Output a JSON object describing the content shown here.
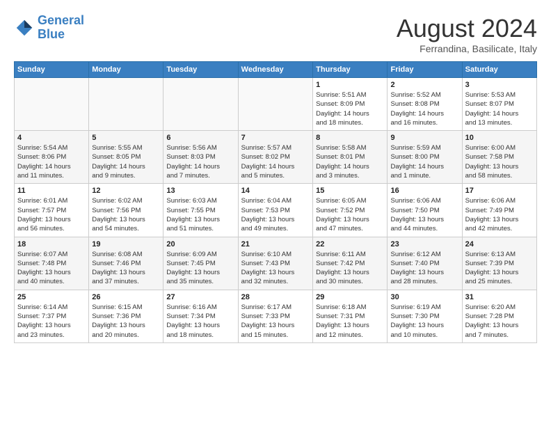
{
  "header": {
    "logo_line1": "General",
    "logo_line2": "Blue",
    "month": "August 2024",
    "location": "Ferrandina, Basilicate, Italy"
  },
  "weekdays": [
    "Sunday",
    "Monday",
    "Tuesday",
    "Wednesday",
    "Thursday",
    "Friday",
    "Saturday"
  ],
  "weeks": [
    [
      {
        "day": "",
        "info": ""
      },
      {
        "day": "",
        "info": ""
      },
      {
        "day": "",
        "info": ""
      },
      {
        "day": "",
        "info": ""
      },
      {
        "day": "1",
        "info": "Sunrise: 5:51 AM\nSunset: 8:09 PM\nDaylight: 14 hours\nand 18 minutes."
      },
      {
        "day": "2",
        "info": "Sunrise: 5:52 AM\nSunset: 8:08 PM\nDaylight: 14 hours\nand 16 minutes."
      },
      {
        "day": "3",
        "info": "Sunrise: 5:53 AM\nSunset: 8:07 PM\nDaylight: 14 hours\nand 13 minutes."
      }
    ],
    [
      {
        "day": "4",
        "info": "Sunrise: 5:54 AM\nSunset: 8:06 PM\nDaylight: 14 hours\nand 11 minutes."
      },
      {
        "day": "5",
        "info": "Sunrise: 5:55 AM\nSunset: 8:05 PM\nDaylight: 14 hours\nand 9 minutes."
      },
      {
        "day": "6",
        "info": "Sunrise: 5:56 AM\nSunset: 8:03 PM\nDaylight: 14 hours\nand 7 minutes."
      },
      {
        "day": "7",
        "info": "Sunrise: 5:57 AM\nSunset: 8:02 PM\nDaylight: 14 hours\nand 5 minutes."
      },
      {
        "day": "8",
        "info": "Sunrise: 5:58 AM\nSunset: 8:01 PM\nDaylight: 14 hours\nand 3 minutes."
      },
      {
        "day": "9",
        "info": "Sunrise: 5:59 AM\nSunset: 8:00 PM\nDaylight: 14 hours\nand 1 minute."
      },
      {
        "day": "10",
        "info": "Sunrise: 6:00 AM\nSunset: 7:58 PM\nDaylight: 13 hours\nand 58 minutes."
      }
    ],
    [
      {
        "day": "11",
        "info": "Sunrise: 6:01 AM\nSunset: 7:57 PM\nDaylight: 13 hours\nand 56 minutes."
      },
      {
        "day": "12",
        "info": "Sunrise: 6:02 AM\nSunset: 7:56 PM\nDaylight: 13 hours\nand 54 minutes."
      },
      {
        "day": "13",
        "info": "Sunrise: 6:03 AM\nSunset: 7:55 PM\nDaylight: 13 hours\nand 51 minutes."
      },
      {
        "day": "14",
        "info": "Sunrise: 6:04 AM\nSunset: 7:53 PM\nDaylight: 13 hours\nand 49 minutes."
      },
      {
        "day": "15",
        "info": "Sunrise: 6:05 AM\nSunset: 7:52 PM\nDaylight: 13 hours\nand 47 minutes."
      },
      {
        "day": "16",
        "info": "Sunrise: 6:06 AM\nSunset: 7:50 PM\nDaylight: 13 hours\nand 44 minutes."
      },
      {
        "day": "17",
        "info": "Sunrise: 6:06 AM\nSunset: 7:49 PM\nDaylight: 13 hours\nand 42 minutes."
      }
    ],
    [
      {
        "day": "18",
        "info": "Sunrise: 6:07 AM\nSunset: 7:48 PM\nDaylight: 13 hours\nand 40 minutes."
      },
      {
        "day": "19",
        "info": "Sunrise: 6:08 AM\nSunset: 7:46 PM\nDaylight: 13 hours\nand 37 minutes."
      },
      {
        "day": "20",
        "info": "Sunrise: 6:09 AM\nSunset: 7:45 PM\nDaylight: 13 hours\nand 35 minutes."
      },
      {
        "day": "21",
        "info": "Sunrise: 6:10 AM\nSunset: 7:43 PM\nDaylight: 13 hours\nand 32 minutes."
      },
      {
        "day": "22",
        "info": "Sunrise: 6:11 AM\nSunset: 7:42 PM\nDaylight: 13 hours\nand 30 minutes."
      },
      {
        "day": "23",
        "info": "Sunrise: 6:12 AM\nSunset: 7:40 PM\nDaylight: 13 hours\nand 28 minutes."
      },
      {
        "day": "24",
        "info": "Sunrise: 6:13 AM\nSunset: 7:39 PM\nDaylight: 13 hours\nand 25 minutes."
      }
    ],
    [
      {
        "day": "25",
        "info": "Sunrise: 6:14 AM\nSunset: 7:37 PM\nDaylight: 13 hours\nand 23 minutes."
      },
      {
        "day": "26",
        "info": "Sunrise: 6:15 AM\nSunset: 7:36 PM\nDaylight: 13 hours\nand 20 minutes."
      },
      {
        "day": "27",
        "info": "Sunrise: 6:16 AM\nSunset: 7:34 PM\nDaylight: 13 hours\nand 18 minutes."
      },
      {
        "day": "28",
        "info": "Sunrise: 6:17 AM\nSunset: 7:33 PM\nDaylight: 13 hours\nand 15 minutes."
      },
      {
        "day": "29",
        "info": "Sunrise: 6:18 AM\nSunset: 7:31 PM\nDaylight: 13 hours\nand 12 minutes."
      },
      {
        "day": "30",
        "info": "Sunrise: 6:19 AM\nSunset: 7:30 PM\nDaylight: 13 hours\nand 10 minutes."
      },
      {
        "day": "31",
        "info": "Sunrise: 6:20 AM\nSunset: 7:28 PM\nDaylight: 13 hours\nand 7 minutes."
      }
    ]
  ]
}
